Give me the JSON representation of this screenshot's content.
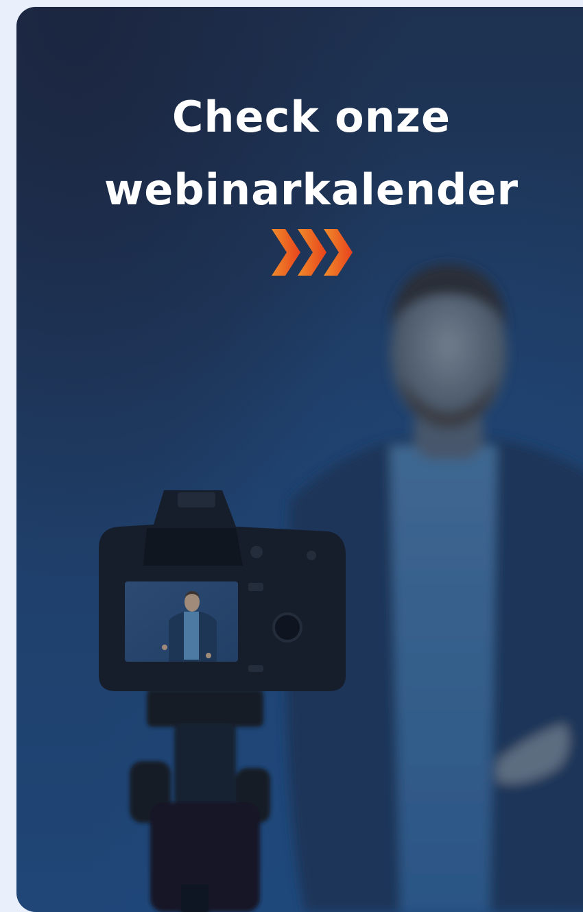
{
  "banner": {
    "headline_line1": "Check onze",
    "headline_line2": "webinarkalender",
    "arrow_icon": "triple-chevron-right-icon",
    "colors": {
      "card_top": "#1b2640",
      "card_bottom": "#1f4677",
      "arrow_light": "#f08b2a",
      "arrow_dark": "#e8431d",
      "page_background": "#e9f0fb"
    }
  }
}
